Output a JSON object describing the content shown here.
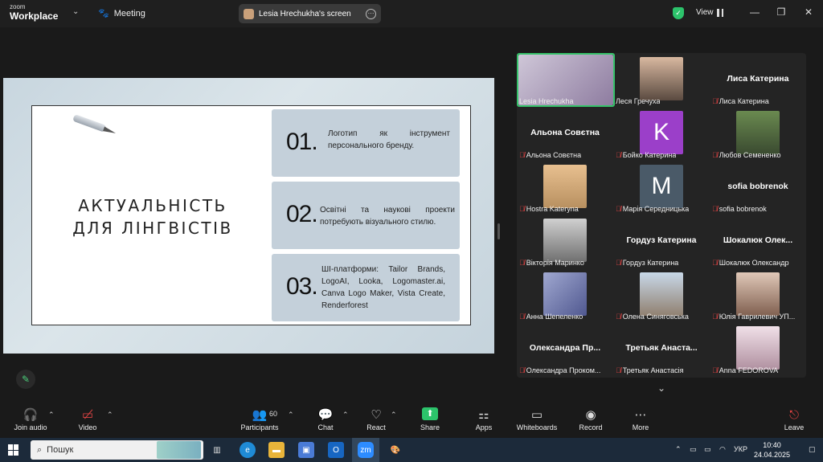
{
  "titlebar": {
    "logo_line1": "zoom",
    "logo_line2": "Workplace",
    "meeting_label": "Meeting",
    "screen_share_label": "Lesia Hrechukha's screen",
    "view_label": "View",
    "colors": {
      "shield": "#2cc36b"
    }
  },
  "slide": {
    "title_line1": "АКТУАЛЬНІСТЬ",
    "title_line2": "ДЛЯ ЛІНГВІСТІВ",
    "cards": [
      {
        "num": "01.",
        "text": "Логотип як інструмент персонального бренду."
      },
      {
        "num": "02.",
        "text": "Освітні та наукові проекти потребують візуального стилю."
      },
      {
        "num": "03.",
        "text": "ШІ-платформи: Tailor Brands, LogoAI, Looka, Logomaster.ai, Canva Logo Maker, Vista Create, Renderforest"
      }
    ]
  },
  "gallery": {
    "tiles": [
      {
        "label": "Lesia Hrechukha",
        "type": "video",
        "muted": false
      },
      {
        "label": "Леся Гречуха",
        "type": "photo",
        "muted": false
      },
      {
        "label": "Лиса Катерина",
        "big": "Лиса Катерина",
        "type": "name",
        "muted": true
      },
      {
        "label": "Альона Совєтна",
        "big": "Альона Совєтна",
        "type": "name",
        "muted": true
      },
      {
        "label": "Бойко Катерина",
        "letter": "K",
        "type": "letter",
        "muted": true
      },
      {
        "label": "Любов Семененко",
        "type": "photo",
        "muted": true
      },
      {
        "label": "Hostra Kateryna",
        "type": "photo",
        "muted": true
      },
      {
        "label": "Марія Середницька",
        "letter": "M",
        "type": "letter",
        "muted": true
      },
      {
        "label": "sofia bobrenok",
        "big": "sofia bobrenok",
        "type": "name",
        "muted": true
      },
      {
        "label": "Вікторія Маринко",
        "type": "photo",
        "muted": true
      },
      {
        "label": "Гордуз Катерина",
        "big": "Гордуз Катерина",
        "type": "name",
        "muted": true
      },
      {
        "label": "Шокалюк Олександр",
        "big": "Шокалюк Олек...",
        "type": "name",
        "muted": true
      },
      {
        "label": "Анна Шепеленко",
        "type": "photo",
        "muted": true
      },
      {
        "label": "Олена Синяговська",
        "type": "photo",
        "muted": true
      },
      {
        "label": "Юлія Гаврилевич УП...",
        "type": "photo",
        "muted": true
      },
      {
        "label": "Олександра Проком...",
        "big": "Олександра Пр...",
        "type": "name",
        "muted": true
      },
      {
        "label": "Третьяк Анастасія",
        "big": "Третьяк Анаста...",
        "type": "name",
        "muted": true
      },
      {
        "label": "Anna FEDOROVA",
        "type": "photo",
        "muted": true
      }
    ]
  },
  "toolbar": {
    "join_audio": "Join audio",
    "video": "Video",
    "participants": "Participants",
    "participants_count": "60",
    "chat": "Chat",
    "react": "React",
    "share": "Share",
    "apps": "Apps",
    "whiteboards": "Whiteboards",
    "record": "Record",
    "more": "More",
    "leave": "Leave"
  },
  "taskbar": {
    "search_placeholder": "Пошук",
    "lang": "УКР",
    "time": "10:40",
    "date": "24.04.2025"
  }
}
